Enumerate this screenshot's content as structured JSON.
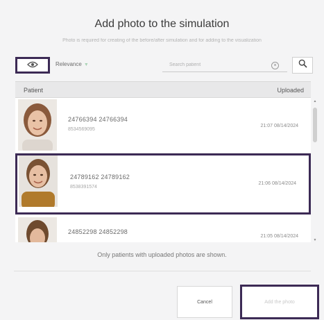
{
  "dialog": {
    "title": "Add photo to the simulation",
    "subtitle": "Photo is required for creating of the before/after simulation and for adding to the visualization"
  },
  "toolbar": {
    "sort_icon": "eye-icon",
    "sort_label": "Relevance",
    "search_placeholder": "Search patient",
    "clear_icon": "clear-icon",
    "search_icon": "search-icon"
  },
  "table": {
    "headers": {
      "patient": "Patient",
      "uploaded": "Uploaded"
    },
    "rows": [
      {
        "name": "24766394 24766394",
        "id": "8534569095",
        "date": "21:07 08/14/2024"
      },
      {
        "name": "24789162 24789162",
        "id": "8538391574",
        "date": "21:06 08/14/2024"
      },
      {
        "name": "24852298 24852298",
        "id": "",
        "date": "21:05 08/14/2024"
      }
    ]
  },
  "note": "Only patients with uploaded photos are shown.",
  "buttons": {
    "cancel": "Cancel",
    "add": "Add the photo"
  },
  "colors": {
    "highlight": "#3c2a55",
    "accent": "#a9d3b5"
  }
}
